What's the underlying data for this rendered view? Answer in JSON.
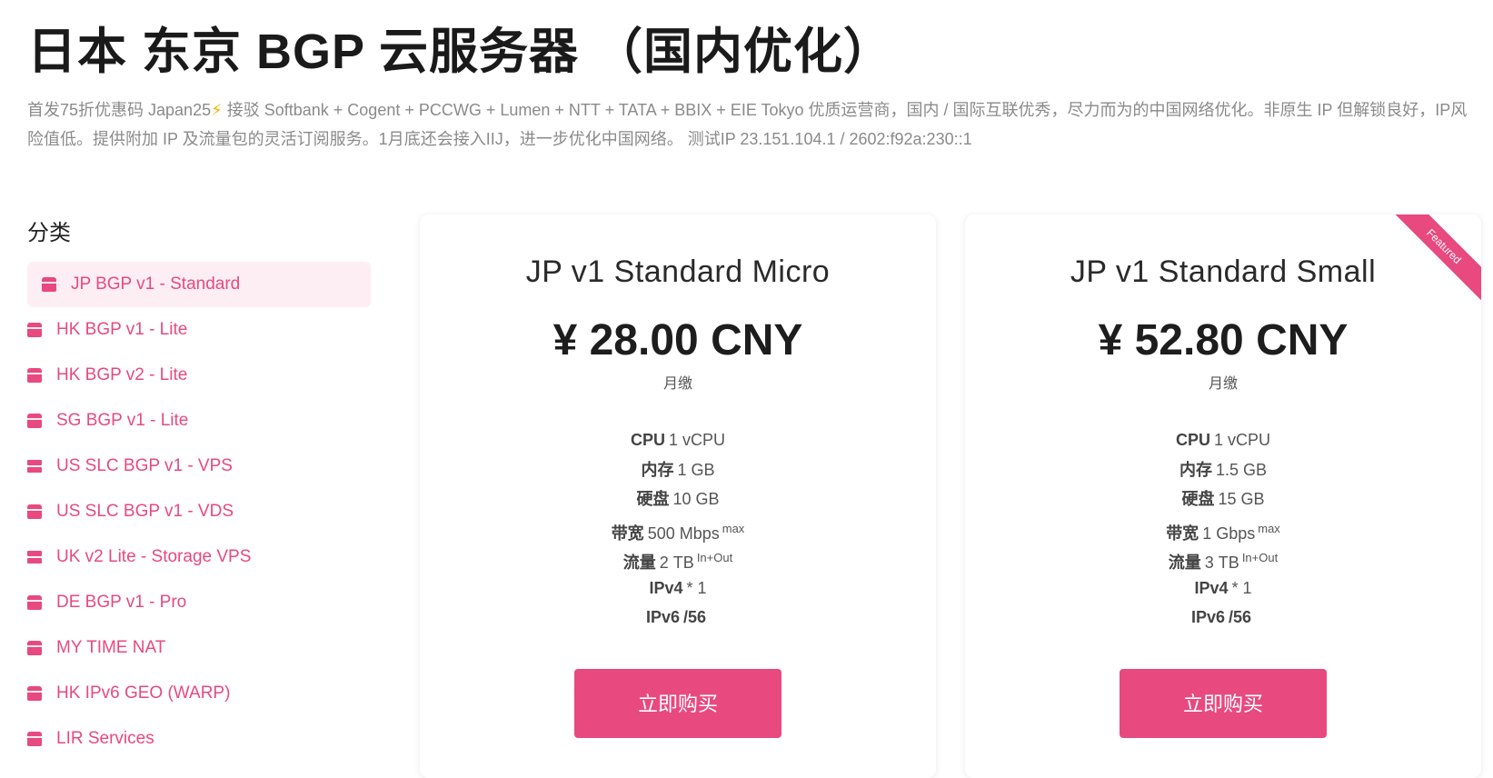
{
  "page": {
    "title": "日本 东京 BGP 云服务器 （国内优化）",
    "description_before_icon": "首发75折优惠码 Japan25",
    "description_after_icon": " 接驳 Softbank + Cogent + PCCWG + Lumen + NTT + TATA + BBIX + EIE Tokyo 优质运营商，国内 / 国际互联优秀，尽力而为的中国网络优化。非原生 IP 但解锁良好，IP风险值低。提供附加 IP 及流量包的灵活订阅服务。1月底还会接入IIJ，进一步优化中国网络。 测试IP 23.151.104.1 / 2602:f92a:230::1",
    "lightning_icon": "lightning-icon",
    "lightning_color": "#f5b400"
  },
  "sidebar": {
    "title": "分类",
    "items": [
      {
        "label": "JP BGP v1 - Standard",
        "icon": "box-icon",
        "active": true
      },
      {
        "label": "HK BGP v1 - Lite",
        "icon": "box-icon"
      },
      {
        "label": "HK BGP v2 - Lite",
        "icon": "box-icon"
      },
      {
        "label": "SG BGP v1 - Lite",
        "icon": "box-icon"
      },
      {
        "label": "US SLC BGP v1 - VPS",
        "icon": "server-icon"
      },
      {
        "label": "US SLC BGP v1 - VDS",
        "icon": "box-icon"
      },
      {
        "label": "UK v2 Lite - Storage VPS",
        "icon": "server-icon"
      },
      {
        "label": "DE BGP v1 - Pro",
        "icon": "box-icon"
      },
      {
        "label": "MY TIME NAT",
        "icon": "box-icon"
      },
      {
        "label": "HK IPv6 GEO (WARP)",
        "icon": "box-icon"
      },
      {
        "label": "LIR Services",
        "icon": "box-icon"
      }
    ]
  },
  "products": [
    {
      "name": "JP v1 Standard Micro",
      "price": "¥ 28.00 CNY",
      "cycle": "月缴",
      "specs": {
        "cpu_label": "CPU",
        "cpu_value": "1 vCPU",
        "ram_label": "内存",
        "ram_value": "1 GB",
        "disk_label": "硬盘",
        "disk_value": "10 GB",
        "bw_label": "带宽",
        "bw_value": "500 Mbps",
        "bw_sup": "max",
        "traffic_label": "流量",
        "traffic_value": "2 TB",
        "traffic_sup": "In+Out",
        "ipv4_label": "IPv4",
        "ipv4_value": "* 1",
        "ipv6_label": "IPv6",
        "ipv6_value": "/56"
      },
      "button": "立即购买"
    },
    {
      "name": "JP v1 Standard Small",
      "price": "¥ 52.80 CNY",
      "cycle": "月缴",
      "badge": "Featured",
      "specs": {
        "cpu_label": "CPU",
        "cpu_value": "1 vCPU",
        "ram_label": "内存",
        "ram_value": "1.5 GB",
        "disk_label": "硬盘",
        "disk_value": "15 GB",
        "bw_label": "带宽",
        "bw_value": "1 Gbps",
        "bw_sup": "max",
        "traffic_label": "流量",
        "traffic_value": "3 TB",
        "traffic_sup": "In+Out",
        "ipv4_label": "IPv4",
        "ipv4_value": "* 1",
        "ipv6_label": "IPv6",
        "ipv6_value": "/56"
      },
      "button": "立即购买"
    }
  ],
  "colors": {
    "accent": "#e8497f",
    "active_bg": "#fdeef3",
    "text_muted": "#8a8a8a"
  }
}
